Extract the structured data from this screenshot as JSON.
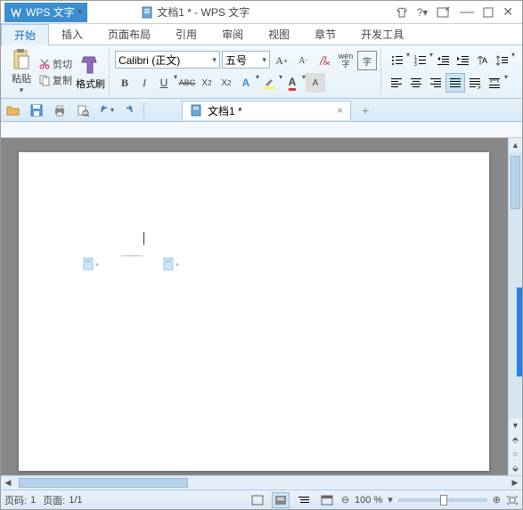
{
  "title": {
    "app_name": "WPS 文字",
    "doc_title": "文档1 * - WPS 文字"
  },
  "tabs": {
    "start": "开始",
    "insert": "插入",
    "page_layout": "页面布局",
    "references": "引用",
    "review": "审阅",
    "view": "视图",
    "chapter": "章节",
    "dev_tools": "开发工具"
  },
  "ribbon": {
    "cut": "剪切",
    "copy": "复制",
    "paste": "粘贴",
    "format_painter": "格式刷",
    "font_name": "Calibri (正文)",
    "font_size": "五号",
    "bold": "B",
    "italic": "I",
    "underline": "U",
    "strike": "ABC",
    "superscript": "X²",
    "subscript": "X₂",
    "wen": "wén",
    "zi": "字"
  },
  "doc_tab": {
    "label": "文档1 *"
  },
  "status": {
    "page_code_label": "页码:",
    "page_code": "1",
    "page_label": "页面:",
    "page": "1/1",
    "zoom": "100 %"
  }
}
